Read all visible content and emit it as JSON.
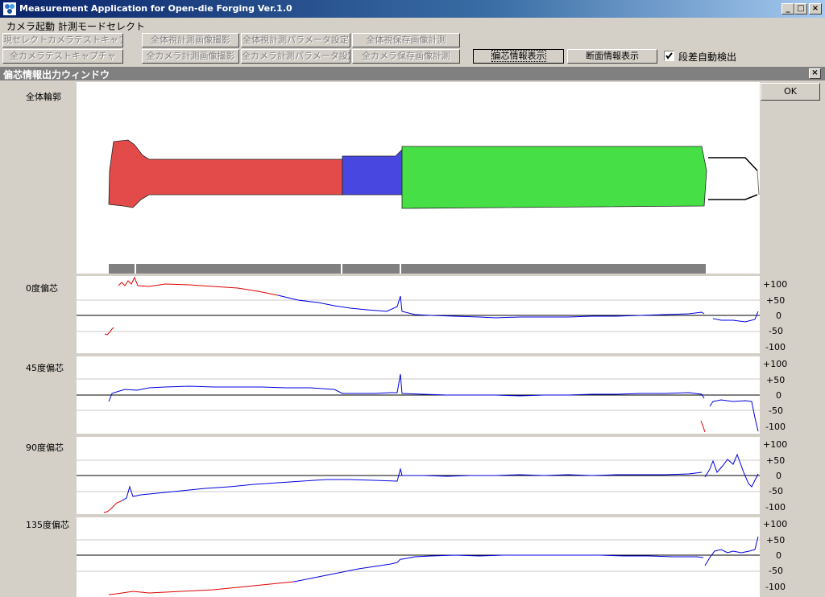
{
  "window": {
    "title": "Measurement Application for Open-die Forging Ver.1.0",
    "min": "_",
    "max": "□",
    "close": "×"
  },
  "menu": [
    "カメラ起動",
    "計測モードセレクト"
  ],
  "toolbar": {
    "row1": [
      "現セレクトカメラテストキャプチャ",
      "全体視計測画像撮影",
      "全体視計測パラメータ設定",
      "全体視保存画像計測"
    ],
    "row2": [
      "全カメラテストキャプチャ",
      "全カメラ計測画像撮影",
      "全カメラ計測パラメータ設定",
      "全カメラ保存画像計測"
    ],
    "eccentric_button": "偏芯情報表示",
    "section_button": "断面情報表示",
    "auto_step_label": "段差自動検出",
    "auto_step_checked": true
  },
  "subwindow": {
    "title": "偏芯情報出力ウィンドウ",
    "close": "×",
    "ok": "OK"
  },
  "overview": {
    "label": "全体輪郭",
    "colors": {
      "red": "#e34b4b",
      "blue": "#4848e0",
      "green": "#46e046"
    }
  },
  "axis_ticks": [
    "+100",
    "+50",
    "0",
    "-50",
    "-100"
  ],
  "charts": [
    {
      "label": "0度偏芯"
    },
    {
      "label": "45度偏芯"
    },
    {
      "label": "90度偏芯"
    },
    {
      "label": "135度偏芯"
    }
  ]
}
